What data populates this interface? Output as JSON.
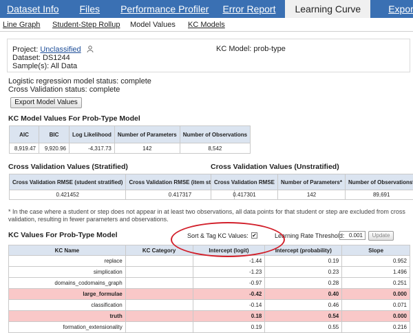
{
  "topnav": {
    "tabs": [
      "Dataset Info",
      "Files",
      "Performance Profiler",
      "Error Report",
      "Learning Curve",
      "Export"
    ],
    "active": "Learning Curve"
  },
  "subnav": {
    "items": [
      "Line Graph",
      "Student-Step Rollup",
      "Model Values",
      "KC Models"
    ],
    "active": "Model Values"
  },
  "info": {
    "project_label": "Project:",
    "project_value": "Unclassified",
    "dataset_label": "Dataset:",
    "dataset_value": "DS1244",
    "samples_label": "Sample(s):",
    "samples_value": "All Data",
    "kc_model": "KC Model: prob-type"
  },
  "status": {
    "logistic": "Logistic regression model status: complete",
    "crossval": "Cross Validation status: complete"
  },
  "export_button": "Export Model Values",
  "model_values": {
    "title": "KC Model Values For Prob-Type Model",
    "headers": [
      "AIC",
      "BIC",
      "Log Likelihood",
      "Number of Parameters",
      "Number of Observations"
    ],
    "values": [
      "8,919.47",
      "9,920.96",
      "-4,317.73",
      "142",
      "8,542"
    ]
  },
  "cv_stratified": {
    "title": "Cross Validation Values (Stratified)",
    "headers": [
      "Cross Validation RMSE (student stratified)",
      "Cross Validation RMSE (item stratified)"
    ],
    "values": [
      "0.421452",
      "0.417317"
    ]
  },
  "cv_unstratified": {
    "title": "Cross Validation Values (Unstratified)",
    "headers": [
      "Cross Validation RMSE",
      "Number of Parameters*",
      "Number of Observations*"
    ],
    "values": [
      "0.417301",
      "142",
      "89,691"
    ]
  },
  "note": "* In the case where a student or step does not appear in at least two observations, all data points for that student or step are excluded from cross validation, resulting in fewer parameters and observations.",
  "kc_values": {
    "title": "KC Values For Prob-Type Model",
    "sort_label": "Sort & Tag KC Values:",
    "sort_checked": "✔",
    "lr_label": "Learning Rate Threshold:",
    "lr_value": "0.001",
    "update_button": "Update",
    "headers": [
      "KC Name",
      "KC Category",
      "Intercept (logit)",
      "Intercept (probability)",
      "Slope"
    ],
    "rows": [
      {
        "name": "replace",
        "category": "",
        "logit": "-1.44",
        "prob": "0.19",
        "slope": "0.952",
        "highlight": false
      },
      {
        "name": "simplication",
        "category": "",
        "logit": "-1.23",
        "prob": "0.23",
        "slope": "1.496",
        "highlight": false
      },
      {
        "name": "domains_codomains_graph",
        "category": "",
        "logit": "-0.97",
        "prob": "0.28",
        "slope": "0.251",
        "highlight": false
      },
      {
        "name": "large_formulae",
        "category": "",
        "logit": "-0.42",
        "prob": "0.40",
        "slope": "0.000",
        "highlight": true
      },
      {
        "name": "classification",
        "category": "",
        "logit": "-0.14",
        "prob": "0.46",
        "slope": "0.071",
        "highlight": false
      },
      {
        "name": "truth",
        "category": "",
        "logit": "0.18",
        "prob": "0.54",
        "slope": "0.000",
        "highlight": true
      },
      {
        "name": "formation_extensionality",
        "category": "",
        "logit": "0.19",
        "prob": "0.55",
        "slope": "0.216",
        "highlight": false
      }
    ]
  },
  "colors": {
    "nav_bg": "#3a70b3",
    "table_header_bg": "#dbe4f0",
    "highlight_row": "#f9c8c8",
    "annotation_ellipse": "#d21f2a"
  }
}
